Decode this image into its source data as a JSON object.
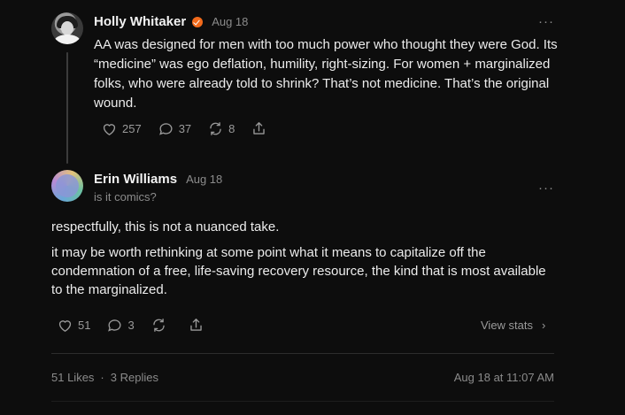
{
  "post": {
    "author": "Holly Whitaker",
    "date": "Aug 18",
    "more": "···",
    "body": "AA was designed for men with too much power who thought they were God. Its “medicine” was ego deflation, humility, right-sizing. For women + marginalized folks, who were already told to shrink? That’s not medicine. That’s the original wound.",
    "likes": "257",
    "comments": "37",
    "restacks": "8"
  },
  "reply": {
    "author": "Erin Williams",
    "date": "Aug 18",
    "handle": "is it comics?",
    "more": "···",
    "paragraphs": [
      "respectfully, this is not a nuanced take.",
      "it may be worth rethinking at some point what it means to capitalize off the condemnation of a free, life-saving recovery resource, the kind that is most available to the marginalized."
    ],
    "likes": "51",
    "comments": "3",
    "view_stats": "View stats",
    "chevron": "›"
  },
  "footer": {
    "likes": "51 Likes",
    "separator": "·",
    "replies": "3 Replies",
    "timestamp": "Aug 18 at 11:07 AM"
  },
  "colors": {
    "background": "#0d0d0d",
    "verified": "#f26a1b",
    "muted": "#8b8b8b"
  },
  "icons": [
    "heart-icon",
    "comment-icon",
    "restack-icon",
    "share-icon",
    "more-icon",
    "verified-badge-icon",
    "chevron-right-icon"
  ]
}
